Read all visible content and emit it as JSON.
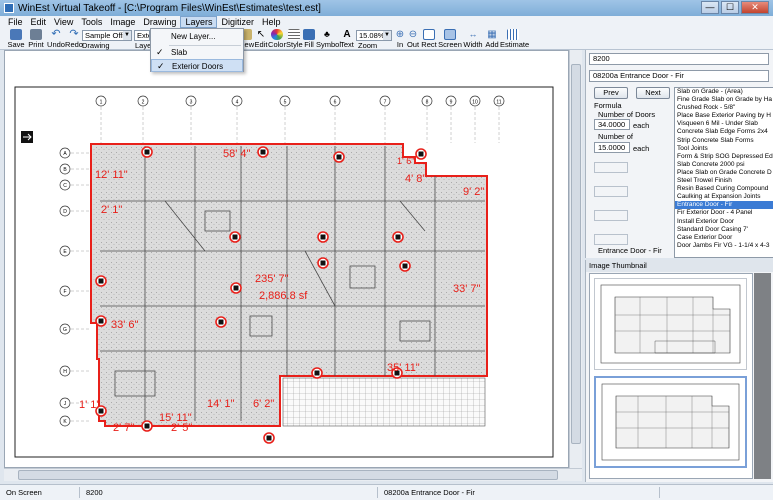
{
  "window": {
    "title": "WinEst Virtual Takeoff - [C:\\Program Files\\WinEst\\Estimates\\test.est]",
    "min": "—",
    "max": "☐",
    "close": "✕"
  },
  "menu": [
    "File",
    "Edit",
    "View",
    "Tools",
    "Image",
    "Drawing",
    "Layers",
    "Digitizer",
    "Help"
  ],
  "toolbar": {
    "left": [
      {
        "label": "Save",
        "icon": "save-icon",
        "color": "#4a78b8"
      },
      {
        "label": "Print",
        "icon": "print-icon",
        "color": "#6d7f95"
      },
      {
        "label": "Undo",
        "icon": "undo-icon",
        "color": "#2f6db5"
      },
      {
        "label": "Redo",
        "icon": "redo-icon",
        "color": "#2f6db5"
      }
    ],
    "office_combo": "Sample Office",
    "layer_combo": "Exter",
    "drawing_label": "Drawing",
    "layer_label": "Layer",
    "right": [
      {
        "label": "View",
        "icon": "view-icon",
        "color": "#c9b26b"
      },
      {
        "label": "Edit",
        "icon": "pointer-icon",
        "color": "#333333"
      },
      {
        "label": "Color",
        "icon": "color-wheel-icon",
        "color": "#d6473a"
      },
      {
        "label": "Style",
        "icon": "style-icon",
        "color": "#6a6a6a"
      },
      {
        "label": "Fill",
        "icon": "fill-icon",
        "color": "#3a6fb4"
      },
      {
        "label": "Symbol",
        "icon": "symbol-icon",
        "color": "#444444"
      },
      {
        "label": "Text",
        "icon": "text-icon",
        "color": "#222222"
      },
      {
        "label": "Zoom",
        "icon": "zoom-icon",
        "color": "#ffffff"
      },
      {
        "label": "In",
        "icon": "zoom-in-icon",
        "color": "#3a6fb4"
      },
      {
        "label": "Out",
        "icon": "zoom-out-icon",
        "color": "#3a6fb4"
      },
      {
        "label": "Rect",
        "icon": "rect-icon",
        "color": "#3a6fb4"
      },
      {
        "label": "Screen",
        "icon": "screen-icon",
        "color": "#3a6fb4"
      },
      {
        "label": "Width",
        "icon": "width-icon",
        "color": "#3a6fb4"
      },
      {
        "label": "Add",
        "icon": "add-icon",
        "color": "#3a6fb4"
      },
      {
        "label": "Estimate",
        "icon": "estimate-icon",
        "color": "#3a6fb4"
      }
    ],
    "zoom_value": "15.08%",
    "zoom_label": "Zoom"
  },
  "layers_menu": {
    "items": [
      {
        "label": "New Layer...",
        "checked": false
      },
      {
        "label": "Slab",
        "checked": true
      },
      {
        "label": "Exterior Doors",
        "checked": true,
        "highlighted": true
      }
    ],
    "check_glyph": "✓"
  },
  "drawing": {
    "accent": "#e8201a",
    "grid_top": [
      "1",
      "2",
      "3",
      "4",
      "5",
      "6",
      "7",
      "8",
      "9",
      "10",
      "11"
    ],
    "grid_left": [
      "A",
      "B",
      "C",
      "D",
      "E",
      "F",
      "G",
      "H",
      "J",
      "K"
    ],
    "measurements": [
      {
        "text": "58' 4\""
      },
      {
        "text": "1' 6\""
      },
      {
        "text": "12' 11\""
      },
      {
        "text": "4' 8\""
      },
      {
        "text": "9' 2\""
      },
      {
        "text": "2' 1\""
      },
      {
        "text": "235' 7\""
      },
      {
        "text": "2,886.8 sf"
      },
      {
        "text": "33' 7\""
      },
      {
        "text": "33' 6\""
      },
      {
        "text": "35' 11\""
      },
      {
        "text": "1' 1\""
      },
      {
        "text": "14' 1\""
      },
      {
        "text": "6' 2\""
      },
      {
        "text": "15' 11\""
      },
      {
        "text": "2' 7\""
      },
      {
        "text": "2' 5\""
      }
    ]
  },
  "panel": {
    "code": "8200",
    "item_desc": "08200a  Entrance Door - Fir",
    "prev": "Prev",
    "next": "Next",
    "formula_label": "Formula",
    "number_of_doors_label": "Number of Doors",
    "value1": "34.0000",
    "unit1": "each",
    "number_of_label": "Number of",
    "value2": "15.0000",
    "unit2": "each",
    "footer_desc": "Entrance Door - Fir",
    "items": [
      {
        "label": "Slab on Grade - (Area)",
        "selected": false
      },
      {
        "label": "Fine Grade Slab on Grade by Ha",
        "selected": false
      },
      {
        "label": "Crushed Rock - 5/8\"",
        "selected": false
      },
      {
        "label": "Place Base Exterior Paving by H",
        "selected": false
      },
      {
        "label": "Visqueen 6 Mil - Under Slab",
        "selected": false
      },
      {
        "label": "Concrete Slab Edge Forms 2x4",
        "selected": false
      },
      {
        "label": "Strip Concrete Slab Forms",
        "selected": false
      },
      {
        "label": "Tool Joints",
        "selected": false
      },
      {
        "label": "Form & Strip SOG Depressed Ed",
        "selected": false
      },
      {
        "label": "Slab Concrete 2000 psi",
        "selected": false
      },
      {
        "label": "Place Slab on Grade Concrete D",
        "selected": false
      },
      {
        "label": "Steel Trowel Finish",
        "selected": false
      },
      {
        "label": "Resin Based Curing Compound",
        "selected": false
      },
      {
        "label": "Caulking at Expansion Joints",
        "selected": false
      },
      {
        "label": "Entrance Door - Fir",
        "selected": true
      },
      {
        "label": "Fir Exterior Door - 4 Panel",
        "selected": false
      },
      {
        "label": "Install Exterior Door",
        "selected": false
      },
      {
        "label": "Standard Door Casing 7'",
        "selected": false
      },
      {
        "label": "Case Exterior Door",
        "selected": false
      },
      {
        "label": "Door Jambs Fir VG - 1-1/4 x 4-3",
        "selected": false
      }
    ]
  },
  "thumbnail": {
    "header": "Image Thumbnail"
  },
  "status": {
    "left": "On Screen",
    "code": "8200",
    "desc": "08200a  Entrance Door - Fir"
  }
}
